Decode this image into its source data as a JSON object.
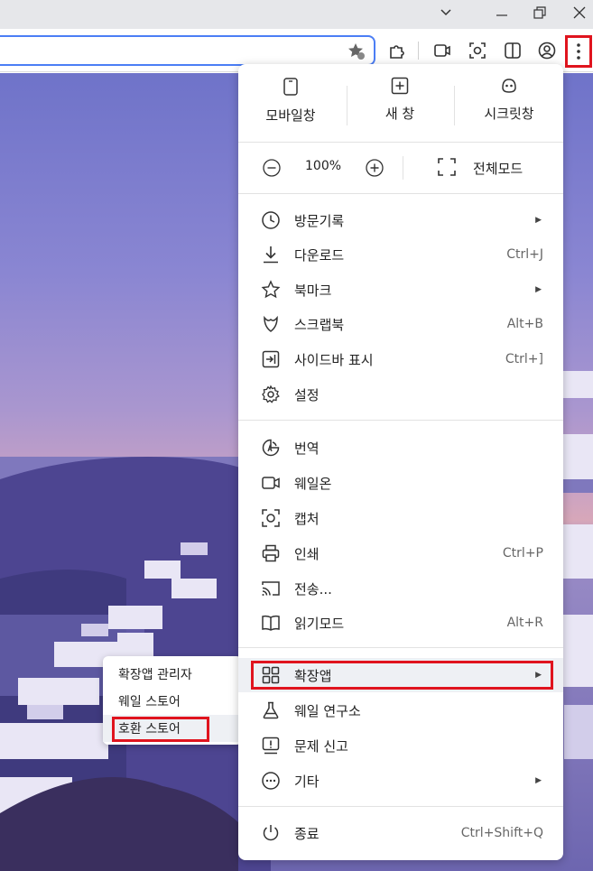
{
  "quick_actions": [
    {
      "label": "모바일창",
      "icon": "mobile-icon"
    },
    {
      "label": "새 창",
      "icon": "new-window-icon"
    },
    {
      "label": "시크릿창",
      "icon": "secret-icon"
    }
  ],
  "zoom": {
    "value": "100%",
    "fullscreen_label": "전체모드"
  },
  "menu_items": [
    {
      "label": "방문기록",
      "shortcut": "",
      "arrow": true,
      "icon": "history-icon"
    },
    {
      "label": "다운로드",
      "shortcut": "Ctrl+J",
      "arrow": false,
      "icon": "download-icon"
    },
    {
      "label": "북마크",
      "shortcut": "",
      "arrow": true,
      "icon": "star-icon"
    },
    {
      "label": "스크랩북",
      "shortcut": "Alt+B",
      "arrow": false,
      "icon": "scrapbook-icon"
    },
    {
      "label": "사이드바 표시",
      "shortcut": "Ctrl+]",
      "arrow": false,
      "icon": "sidebar-icon"
    },
    {
      "label": "설정",
      "shortcut": "",
      "arrow": false,
      "icon": "gear-icon"
    },
    {
      "label": "번역",
      "shortcut": "",
      "arrow": false,
      "icon": "translate-icon"
    },
    {
      "label": "웨일온",
      "shortcut": "",
      "arrow": false,
      "icon": "video-icon"
    },
    {
      "label": "캡처",
      "shortcut": "",
      "arrow": false,
      "icon": "capture-icon"
    },
    {
      "label": "인쇄",
      "shortcut": "Ctrl+P",
      "arrow": false,
      "icon": "printer-icon"
    },
    {
      "label": "전송...",
      "shortcut": "",
      "arrow": false,
      "icon": "cast-icon"
    },
    {
      "label": "읽기모드",
      "shortcut": "Alt+R",
      "arrow": false,
      "icon": "book-icon"
    },
    {
      "label": "확장앱",
      "shortcut": "",
      "arrow": true,
      "icon": "extensions-grid-icon"
    },
    {
      "label": "웨일 연구소",
      "shortcut": "",
      "arrow": false,
      "icon": "flask-icon"
    },
    {
      "label": "문제 신고",
      "shortcut": "",
      "arrow": false,
      "icon": "report-icon"
    },
    {
      "label": "기타",
      "shortcut": "",
      "arrow": true,
      "icon": "more-icon"
    },
    {
      "label": "종료",
      "shortcut": "Ctrl+Shift+Q",
      "arrow": false,
      "icon": "power-icon"
    }
  ],
  "submenu": [
    {
      "label": "확장앱 관리자"
    },
    {
      "label": "웨일 스토어"
    },
    {
      "label": "호환 스토어"
    }
  ],
  "colors": {
    "highlight": "#e0141e",
    "address_border": "#4b7ef5"
  }
}
